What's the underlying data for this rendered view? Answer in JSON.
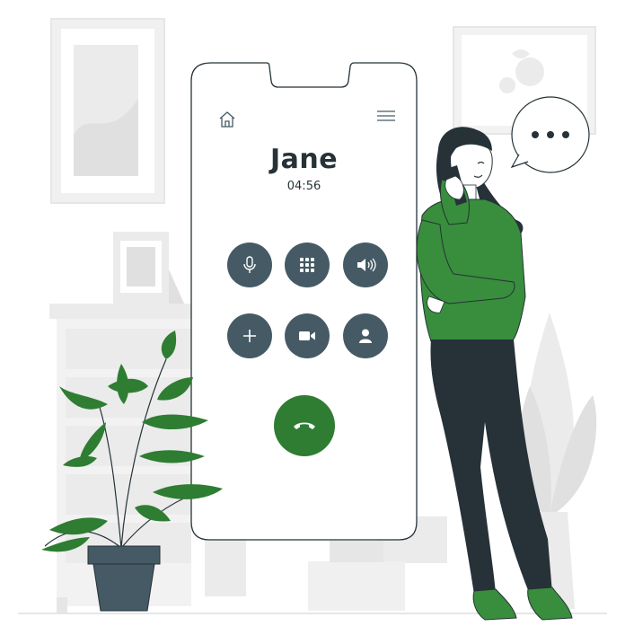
{
  "call_screen": {
    "caller_name": "Jane",
    "call_duration": "04:56",
    "controls": [
      {
        "icon": "microphone-icon",
        "action": "mute"
      },
      {
        "icon": "keypad-icon",
        "action": "keypad"
      },
      {
        "icon": "speaker-icon",
        "action": "speaker"
      },
      {
        "icon": "plus-icon",
        "action": "add-call"
      },
      {
        "icon": "video-camera-icon",
        "action": "video"
      },
      {
        "icon": "contact-icon",
        "action": "contacts"
      }
    ],
    "end_call_icon": "hang-up-phone-icon"
  },
  "colors": {
    "accent_green": "#2e7d32",
    "button_gray": "#455a64",
    "text_dark": "#263238",
    "background_gray": "#ebebeb"
  }
}
